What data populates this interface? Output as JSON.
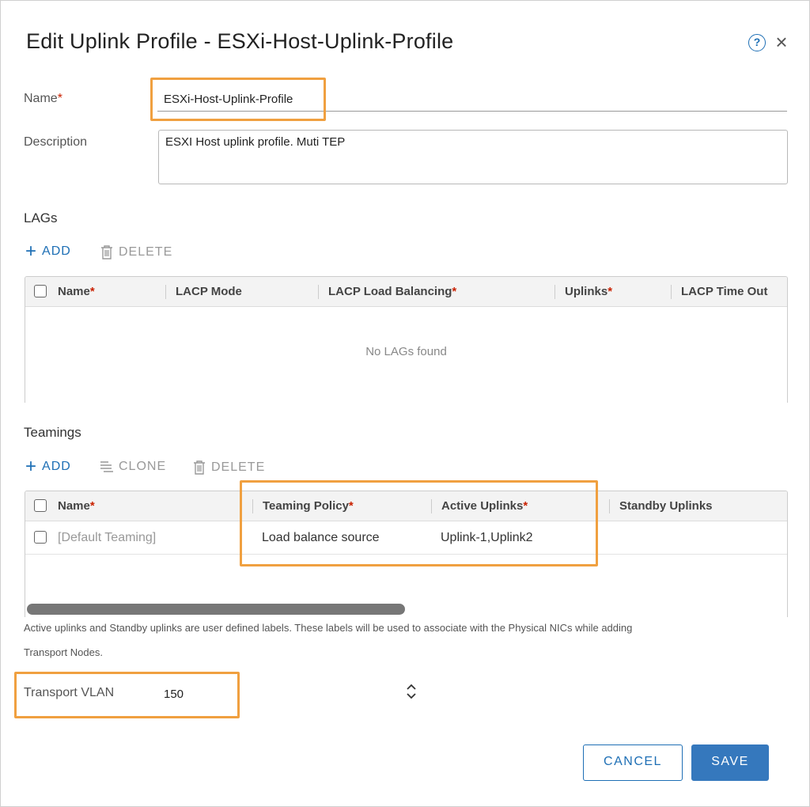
{
  "dialog": {
    "title": "Edit Uplink Profile - ESXi-Host-Uplink-Profile",
    "help_icon": "?",
    "close_icon": "×"
  },
  "form": {
    "name_label": "Name",
    "name_value": "ESXi-Host-Uplink-Profile",
    "required_mark": "*",
    "description_label": "Description",
    "description_value": "ESXI Host uplink profile. Muti TEP"
  },
  "lags": {
    "section_title": "LAGs",
    "add_label": "ADD",
    "delete_label": "DELETE",
    "columns": [
      "Name",
      "LACP Mode",
      "LACP Load Balancing",
      "Uplinks",
      "LACP Time Out"
    ],
    "empty_text": "No LAGs found"
  },
  "teamings": {
    "section_title": "Teamings",
    "add_label": "ADD",
    "clone_label": "CLONE",
    "delete_label": "DELETE",
    "columns": [
      "Name",
      "Teaming Policy",
      "Active Uplinks",
      "Standby Uplinks"
    ],
    "rows": [
      {
        "name": "[Default Teaming]",
        "teaming_policy": "Load balance source",
        "active_uplinks": "Uplink-1,Uplink2",
        "standby_uplinks": ""
      }
    ],
    "hint": "Active uplinks and Standby uplinks are user defined labels. These labels will be used to associate with the Physical NICs while adding",
    "hint_line2": "Transport Nodes."
  },
  "transport_vlan": {
    "label": "Transport VLAN",
    "value": "150"
  },
  "buttons": {
    "cancel": "CANCEL",
    "save": "SAVE"
  },
  "colors": {
    "accent": "#1e6fb5",
    "primary_button": "#3578bd",
    "highlight": "#f0a040",
    "required": "#c92100"
  },
  "icons": {
    "plus": "plus-icon",
    "trash": "trash-icon",
    "clone": "clone-icon",
    "spinner": "spinner-updown-icon"
  }
}
